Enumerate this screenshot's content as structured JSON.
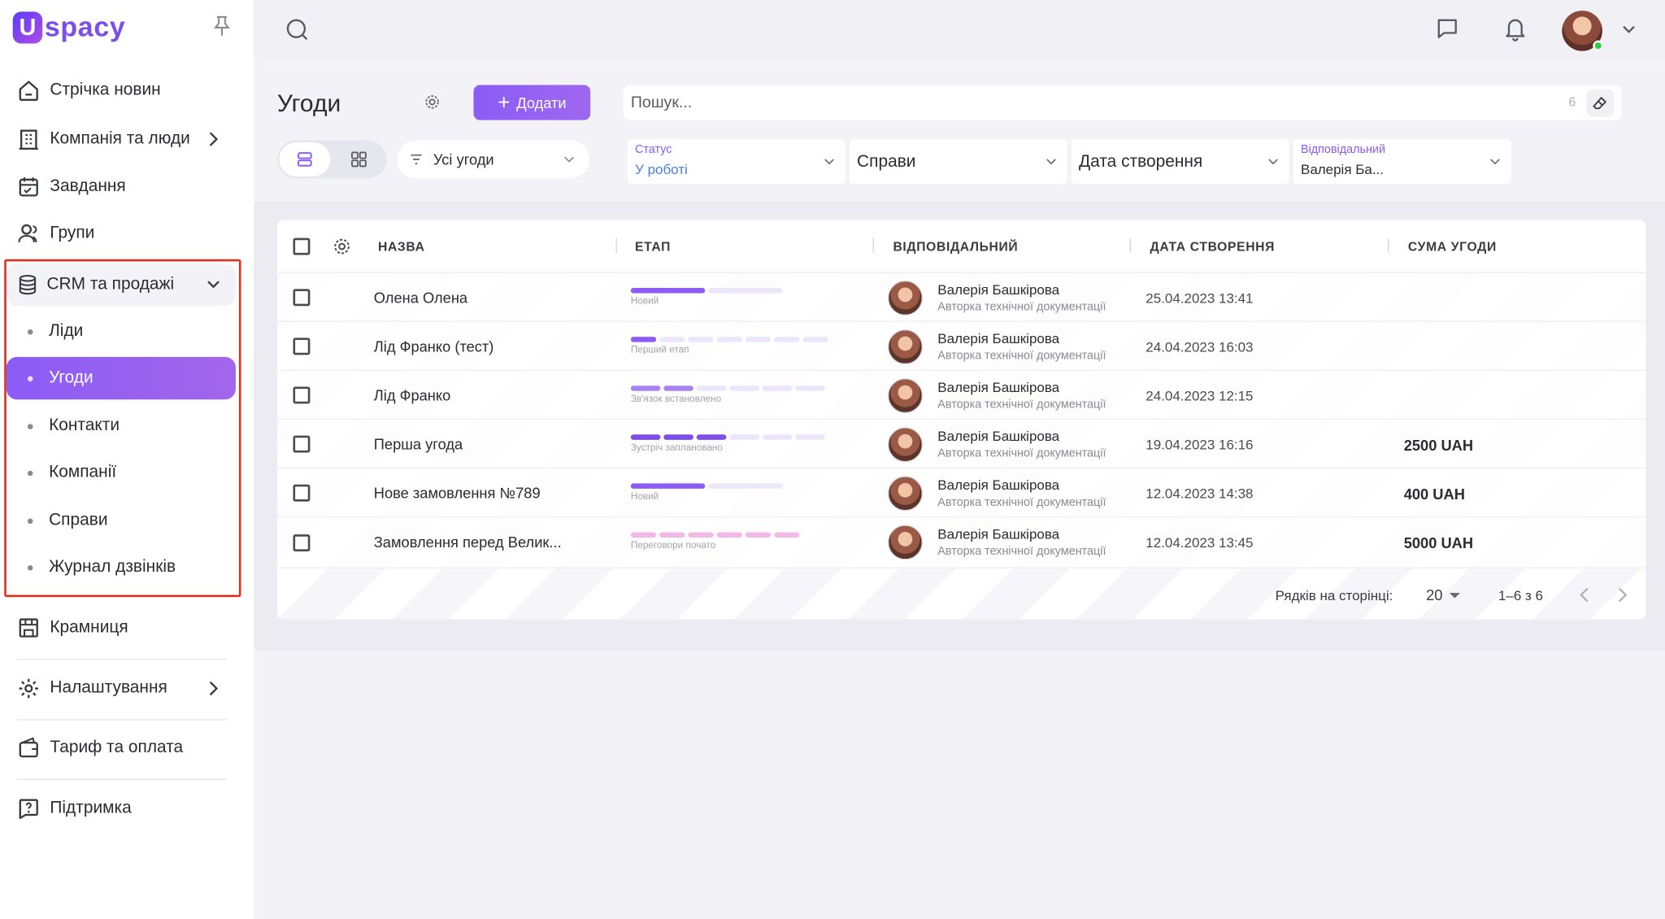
{
  "brand": {
    "logo_letter": "U",
    "logo_text": "spacy"
  },
  "sidebar": {
    "items": [
      {
        "label": "Стрічка новин"
      },
      {
        "label": "Компанія та люди"
      },
      {
        "label": "Завдання"
      },
      {
        "label": "Групи"
      }
    ],
    "crm": {
      "label": "CRM та продажі",
      "subitems": [
        {
          "label": "Ліди"
        },
        {
          "label": "Угоди"
        },
        {
          "label": "Контакти"
        },
        {
          "label": "Компанії"
        },
        {
          "label": "Справи"
        },
        {
          "label": "Журнал дзвінків"
        }
      ]
    },
    "bottom": [
      {
        "label": "Крамниця"
      },
      {
        "label": "Налаштування"
      },
      {
        "label": "Тариф та оплата"
      },
      {
        "label": "Підтримка"
      }
    ]
  },
  "header": {
    "title": "Угоди",
    "add_label": "Додати",
    "search_placeholder": "Пошук...",
    "search_count": "6",
    "deals_select": "Усі угоди"
  },
  "filters": {
    "status": {
      "label": "Статус",
      "value": "У роботі"
    },
    "cases": {
      "label": "Справи"
    },
    "created": {
      "label": "Дата створення"
    },
    "responsible": {
      "label": "Відповідальний",
      "value": "Валерія Ба..."
    }
  },
  "table": {
    "columns": [
      "НАЗВА",
      "ЕТАП",
      "ВІДПОВІДАЛЬНИЙ",
      "ДАТА СТВОРЕННЯ",
      "СУМА УГОДИ"
    ],
    "rows": [
      {
        "name": "Олена Олена",
        "stage": "Новий",
        "person": "Валерія Башкірова",
        "role": "Авторка технічної документації",
        "date": "25.04.2023 13:41",
        "sum": ""
      },
      {
        "name": "Лід Франко (тест)",
        "stage": "Перший етап",
        "person": "Валерія Башкірова",
        "role": "Авторка технічної документації",
        "date": "24.04.2023 16:03",
        "sum": ""
      },
      {
        "name": "Лід Франко",
        "stage": "Зв'язок встановлено",
        "person": "Валерія Башкірова",
        "role": "Авторка технічної документації",
        "date": "24.04.2023 12:15",
        "sum": ""
      },
      {
        "name": "Перша угода",
        "stage": "Зустріч заплановано",
        "person": "Валерія Башкірова",
        "role": "Авторка технічної документації",
        "date": "19.04.2023 16:16",
        "sum": "2500 UAH"
      },
      {
        "name": "Нове замовлення №789",
        "stage": "Новий",
        "person": "Валерія Башкірова",
        "role": "Авторка технічної документації",
        "date": "12.04.2023 14:38",
        "sum": "400 UAH"
      },
      {
        "name": "Замовлення перед Велик...",
        "stage": "Переговори почато",
        "person": "Валерія Башкірова",
        "role": "Авторка технічної документації",
        "date": "12.04.2023 13:45",
        "sum": "5000 UAH"
      }
    ],
    "footer": {
      "rows_per_page_label": "Рядків на сторінці:",
      "rows_per_page": "20",
      "range": "1–6 з 6"
    }
  },
  "colors": {
    "accent": "#8b5cf6",
    "accent_light": "#ece6fb",
    "highlight_border": "#e0311f",
    "stage_pink": "#f1b8e8"
  }
}
